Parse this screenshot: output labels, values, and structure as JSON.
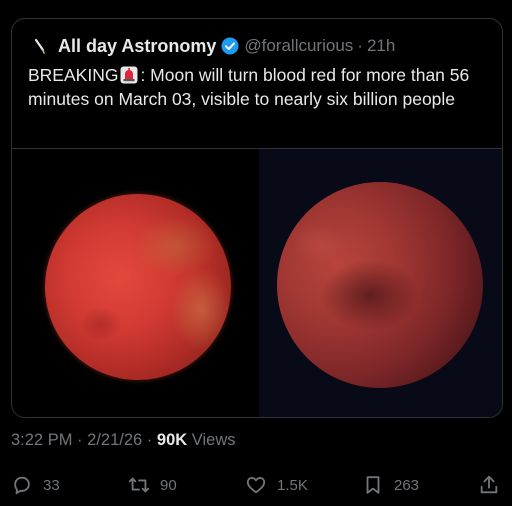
{
  "tweet": {
    "author_name": "All day Astronomy",
    "handle": "@forallcurious",
    "separator": "·",
    "time_ago": "21h",
    "text_before": "BREAKING",
    "text_after": ": Moon will turn blood red for more than 56 minutes on March 03, visible to nearly six billion people"
  },
  "meta": {
    "time": "3:22 PM",
    "sep1": "·",
    "date": "2/21/26",
    "sep2": "·",
    "views_count": "90K",
    "views_label": "Views"
  },
  "actions": {
    "replies": "33",
    "reposts": "90",
    "likes": "1.5K",
    "bookmarks": "263"
  },
  "icons": [
    "telescope-icon",
    "verified-icon",
    "siren-icon",
    "reply-icon",
    "repost-icon",
    "like-icon",
    "bookmark-icon",
    "share-icon"
  ],
  "colors": {
    "background": "#000000",
    "text": "#e7e9ea",
    "muted": "#71767b",
    "verified": "#1d9bf0"
  }
}
